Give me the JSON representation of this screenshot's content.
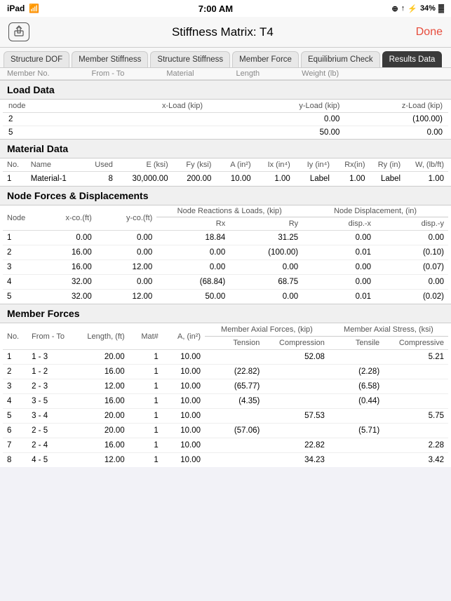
{
  "statusBar": {
    "left": "iPad",
    "time": "7:00 AM",
    "battery": "34%"
  },
  "header": {
    "shareLabel": "↑",
    "title": "Stiffness Matrix: T4",
    "doneLabel": "Done"
  },
  "tabs": [
    {
      "label": "Structure DOF",
      "active": false
    },
    {
      "label": "Member Stiffness",
      "active": false
    },
    {
      "label": "Structure Stiffness",
      "active": false
    },
    {
      "label": "Member Force",
      "active": false
    },
    {
      "label": "Equilibrium Check",
      "active": false
    },
    {
      "label": "Results Data",
      "active": true
    }
  ],
  "partialRow": {
    "cols": [
      "Member No.",
      "From - To",
      "Material",
      "Length",
      "Weight (lb)"
    ]
  },
  "loadData": {
    "sectionTitle": "Load Data",
    "columns": [
      "node",
      "x-Load (kip)",
      "y-Load (kip)",
      "z-Load (kip)"
    ],
    "rows": [
      {
        "node": "2",
        "xLoad": "",
        "yLoad": "0.00",
        "zLoad": "(100.00)"
      },
      {
        "node": "5",
        "xLoad": "",
        "yLoad": "50.00",
        "zLoad": "0.00"
      }
    ]
  },
  "materialData": {
    "sectionTitle": "Material Data",
    "columns": [
      "No.",
      "Name",
      "Used",
      "E (ksi)",
      "Fy (ksi)",
      "A (in²)",
      "Ix (in⁴)",
      "Iy (in⁴)",
      "Rx(in)",
      "Ry (in)",
      "W, (lb/ft)"
    ],
    "rows": [
      {
        "no": "1",
        "name": "Material-1",
        "used": "8",
        "e": "30,000.00",
        "fy": "200.00",
        "a": "10.00",
        "ix": "1.00",
        "iy": "Label",
        "rx": "1.00",
        "ry": "Label",
        "w": "1.00"
      }
    ]
  },
  "nodeForces": {
    "sectionTitle": "Node Forces & Displacements",
    "groupHeaders": {
      "reactions": "Node Reactions & Loads, (kip)",
      "displacement": "Node Displacement, (in)"
    },
    "columns": [
      "Node",
      "x-co.(ft)",
      "y-co.(ft)",
      "Rx",
      "Ry",
      "disp.-x",
      "disp.-y"
    ],
    "rows": [
      {
        "node": "1",
        "x": "0.00",
        "y": "0.00",
        "rx": "18.84",
        "ry": "31.25",
        "dx": "0.00",
        "dy": "0.00"
      },
      {
        "node": "2",
        "x": "16.00",
        "y": "0.00",
        "rx": "0.00",
        "ry": "(100.00)",
        "dx": "0.01",
        "dy": "(0.10)"
      },
      {
        "node": "3",
        "x": "16.00",
        "y": "12.00",
        "rx": "0.00",
        "ry": "0.00",
        "dx": "0.00",
        "dy": "(0.07)"
      },
      {
        "node": "4",
        "x": "32.00",
        "y": "0.00",
        "rx": "(68.84)",
        "ry": "68.75",
        "dx": "0.00",
        "dy": "0.00"
      },
      {
        "node": "5",
        "x": "32.00",
        "y": "12.00",
        "rx": "50.00",
        "ry": "0.00",
        "dx": "0.01",
        "dy": "(0.02)"
      }
    ]
  },
  "memberForces": {
    "sectionTitle": "Member Forces",
    "groupHeaders": {
      "axialForces": "Member Axial Forces, (kip)",
      "axialStress": "Member Axial Stress, (ksi)"
    },
    "columns": [
      "No.",
      "From - To",
      "Length, (ft)",
      "Mat#",
      "A, (in²)",
      "Tension",
      "Compression",
      "Tensile",
      "Compressive"
    ],
    "rows": [
      {
        "no": "1",
        "fromTo": "1 - 3",
        "length": "20.00",
        "mat": "1",
        "a": "10.00",
        "tension": "",
        "compression": "52.08",
        "tensile": "",
        "compressive": "5.21"
      },
      {
        "no": "2",
        "fromTo": "1 - 2",
        "length": "16.00",
        "mat": "1",
        "a": "10.00",
        "tension": "(22.82)",
        "compression": "",
        "tensile": "(2.28)",
        "compressive": ""
      },
      {
        "no": "3",
        "fromTo": "2 - 3",
        "length": "12.00",
        "mat": "1",
        "a": "10.00",
        "tension": "(65.77)",
        "compression": "",
        "tensile": "(6.58)",
        "compressive": ""
      },
      {
        "no": "4",
        "fromTo": "3 - 5",
        "length": "16.00",
        "mat": "1",
        "a": "10.00",
        "tension": "(4.35)",
        "compression": "",
        "tensile": "(0.44)",
        "compressive": ""
      },
      {
        "no": "5",
        "fromTo": "3 - 4",
        "length": "20.00",
        "mat": "1",
        "a": "10.00",
        "tension": "",
        "compression": "57.53",
        "tensile": "",
        "compressive": "5.75"
      },
      {
        "no": "6",
        "fromTo": "2 - 5",
        "length": "20.00",
        "mat": "1",
        "a": "10.00",
        "tension": "(57.06)",
        "compression": "",
        "tensile": "(5.71)",
        "compressive": ""
      },
      {
        "no": "7",
        "fromTo": "2 - 4",
        "length": "16.00",
        "mat": "1",
        "a": "10.00",
        "tension": "",
        "compression": "22.82",
        "tensile": "",
        "compressive": "2.28"
      },
      {
        "no": "8",
        "fromTo": "4 - 5",
        "length": "12.00",
        "mat": "1",
        "a": "10.00",
        "tension": "",
        "compression": "34.23",
        "tensile": "",
        "compressive": "3.42"
      }
    ]
  }
}
